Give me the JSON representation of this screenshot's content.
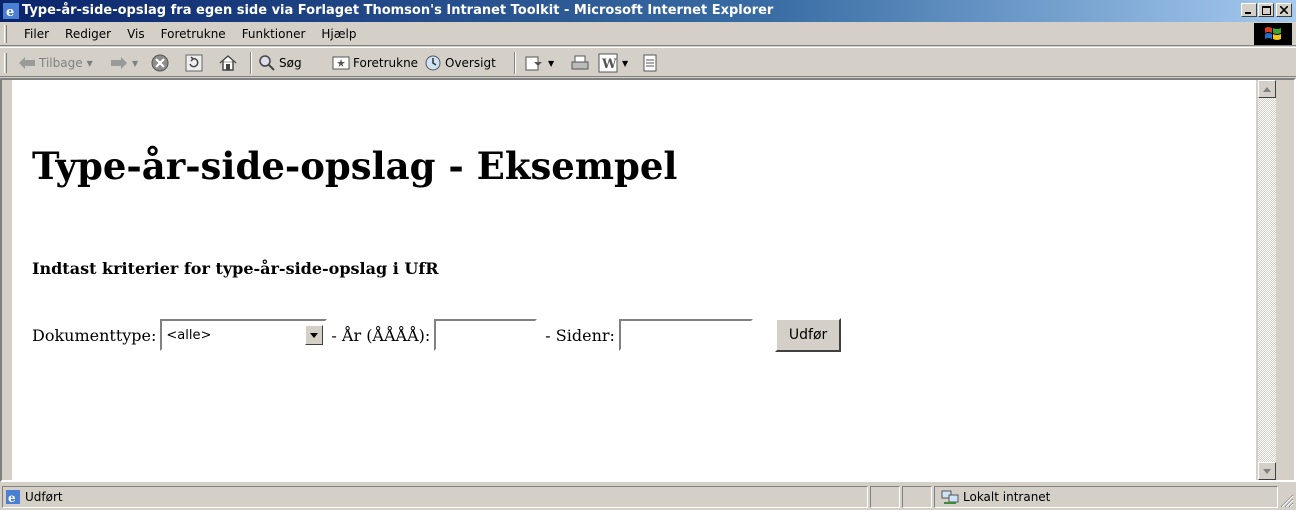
{
  "window": {
    "title": "Type-år-side-opslag fra egen side via Forlaget Thomson's Intranet Toolkit - Microsoft Internet Explorer"
  },
  "menu": {
    "items": [
      {
        "label": "Filer"
      },
      {
        "label": "Rediger"
      },
      {
        "label": "Vis"
      },
      {
        "label": "Foretrukne"
      },
      {
        "label": "Funktioner"
      },
      {
        "label": "Hjælp"
      }
    ]
  },
  "toolbar": {
    "back_label": "Tilbage",
    "search_label": "Søg",
    "favorites_label": "Foretrukne",
    "history_label": "Oversigt"
  },
  "page": {
    "title": "Type-år-side-opslag - Eksempel",
    "subtitle": "Indtast kriterier for type-år-side-opslag i UfR",
    "doctype_label": "Dokumenttype:",
    "doctype_value": "<alle>",
    "year_label": "- År (ÅÅÅÅ):",
    "year_value": "",
    "page_label": "- Sidenr:",
    "page_value": "",
    "submit_label": "Udfør"
  },
  "status": {
    "text": "Udført",
    "zone": "Lokalt intranet"
  },
  "colors": {
    "titlebar_start": "#0a246a",
    "titlebar_end": "#a6caf0",
    "chrome": "#d4d0c8"
  }
}
